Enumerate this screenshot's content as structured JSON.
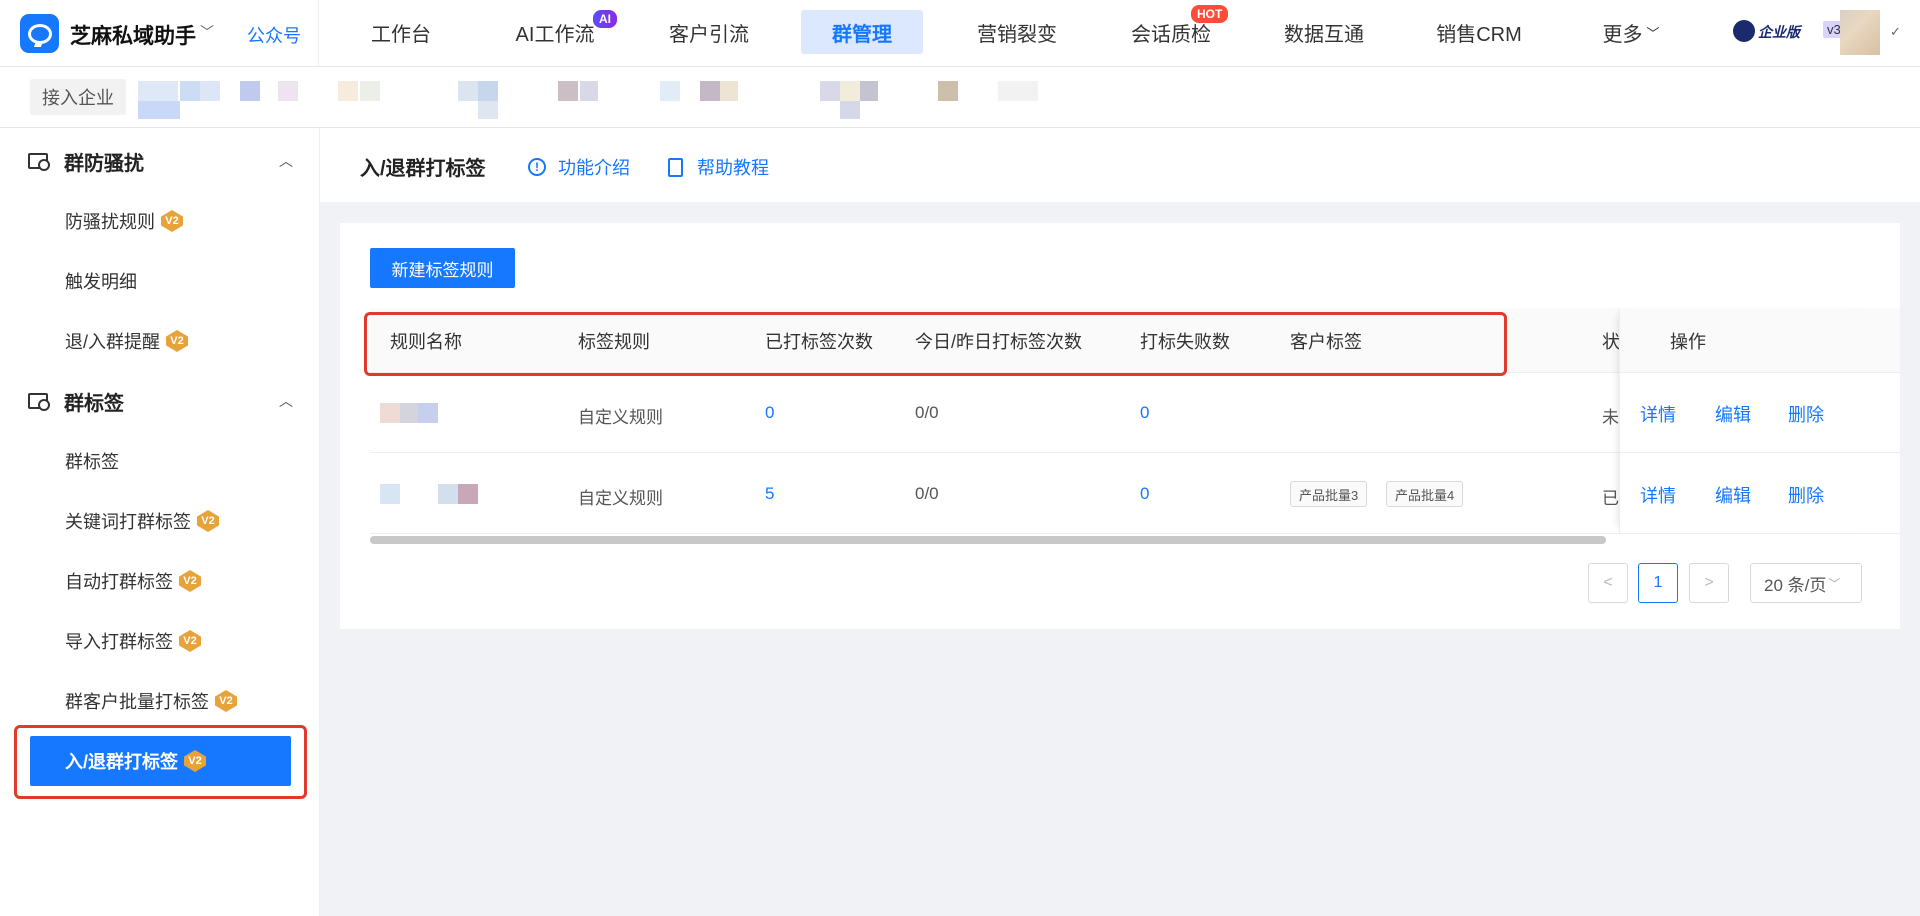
{
  "app": {
    "name": "芝麻私域助手",
    "account_link": "公众号"
  },
  "nav": {
    "items": [
      {
        "label": "工作台"
      },
      {
        "label": "AI工作流",
        "badge": "AI"
      },
      {
        "label": "客户引流"
      },
      {
        "label": "群管理",
        "active": true
      },
      {
        "label": "营销裂变"
      },
      {
        "label": "会话质检",
        "badge": "HOT"
      },
      {
        "label": "数据互通"
      },
      {
        "label": "销售CRM"
      },
      {
        "label": "更多"
      }
    ],
    "edition": "企业版",
    "version": "v3"
  },
  "subbar": {
    "enterprise_label": "接入企业"
  },
  "sidebar": {
    "groups": [
      {
        "title": "群防骚扰",
        "items": [
          {
            "label": "防骚扰规则",
            "badge": "V2"
          },
          {
            "label": "触发明细"
          },
          {
            "label": "退/入群提醒",
            "badge": "V2"
          }
        ]
      },
      {
        "title": "群标签",
        "items": [
          {
            "label": "群标签"
          },
          {
            "label": "关键词打群标签",
            "badge": "V2"
          },
          {
            "label": "自动打群标签",
            "badge": "V2"
          },
          {
            "label": "导入打群标签",
            "badge": "V2"
          },
          {
            "label": "群客户批量打标签",
            "badge": "V2"
          },
          {
            "label": "入/退群打标签",
            "badge": "V2",
            "active": true
          }
        ]
      }
    ]
  },
  "page": {
    "title": "入/退群打标签",
    "intro_link": "功能介绍",
    "help_link": "帮助教程",
    "new_button": "新建标签规则"
  },
  "table": {
    "columns": [
      "规则名称",
      "标签规则",
      "已打标签次数",
      "今日/昨日打标签次数",
      "打标失败数",
      "客户标签",
      "状",
      "操作"
    ],
    "rows": [
      {
        "rule": "自定义规则",
        "count": "0",
        "today_yesterday": "0/0",
        "failed": "0",
        "tags": [],
        "status": "未"
      },
      {
        "rule": "自定义规则",
        "count": "5",
        "today_yesterday": "0/0",
        "failed": "0",
        "tags": [
          "产品批量3",
          "产品批量4"
        ],
        "status": "已"
      }
    ],
    "actions": {
      "detail": "详情",
      "edit": "编辑",
      "delete": "删除"
    }
  },
  "pagination": {
    "prev": "<",
    "current": "1",
    "next": ">",
    "page_size": "20 条/页"
  },
  "colors": {
    "primary": "#1677ff",
    "highlight_box": "#e03a2e",
    "badge_v2": "#e8a23a"
  }
}
